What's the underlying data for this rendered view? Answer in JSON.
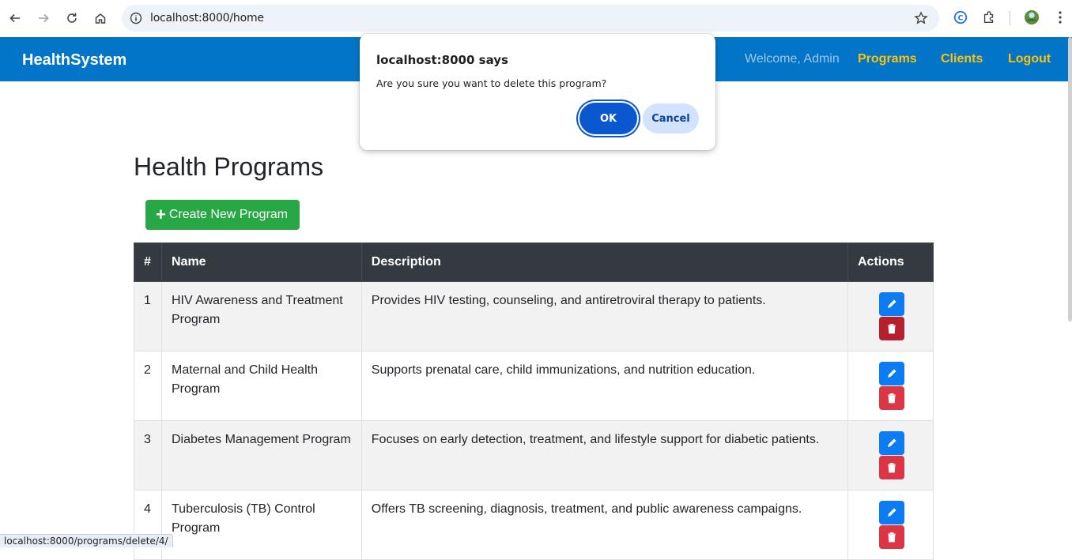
{
  "browser": {
    "url": "localhost:8000/home",
    "status_url": "localhost:8000/programs/delete/4/"
  },
  "navbar": {
    "brand": "HealthSystem",
    "welcome": "Welcome, Admin",
    "links": [
      "Programs",
      "Clients",
      "Logout"
    ]
  },
  "main": {
    "title": "Health Programs",
    "create_label": "Create New Program",
    "table": {
      "headers": [
        "#",
        "Name",
        "Description",
        "Actions"
      ],
      "rows": [
        {
          "num": "1",
          "name": "HIV Awareness and Treatment Program",
          "desc": "Provides HIV testing, counseling, and antiretroviral therapy to patients."
        },
        {
          "num": "2",
          "name": "Maternal and Child Health Program",
          "desc": "Supports prenatal care, child immunizations, and nutrition education."
        },
        {
          "num": "3",
          "name": "Diabetes Management Program",
          "desc": "Focuses on early detection, treatment, and lifestyle support for diabetic patients."
        },
        {
          "num": "4",
          "name": "Tuberculosis (TB) Control Program",
          "desc": "Offers TB screening, diagnosis, treatment, and public awareness campaigns."
        }
      ]
    }
  },
  "dialog": {
    "title": "localhost:8000 says",
    "message": "Are you sure you want to delete this program?",
    "ok_label": "OK",
    "cancel_label": "Cancel"
  },
  "colors": {
    "navbar": "#0275c8",
    "nav_link": "#ffc107",
    "create_button": "#28a745",
    "table_header": "#343a40",
    "edit_button": "#0d7cf2",
    "delete_button": "#dc3545",
    "dialog_ok": "#0b57d0"
  }
}
